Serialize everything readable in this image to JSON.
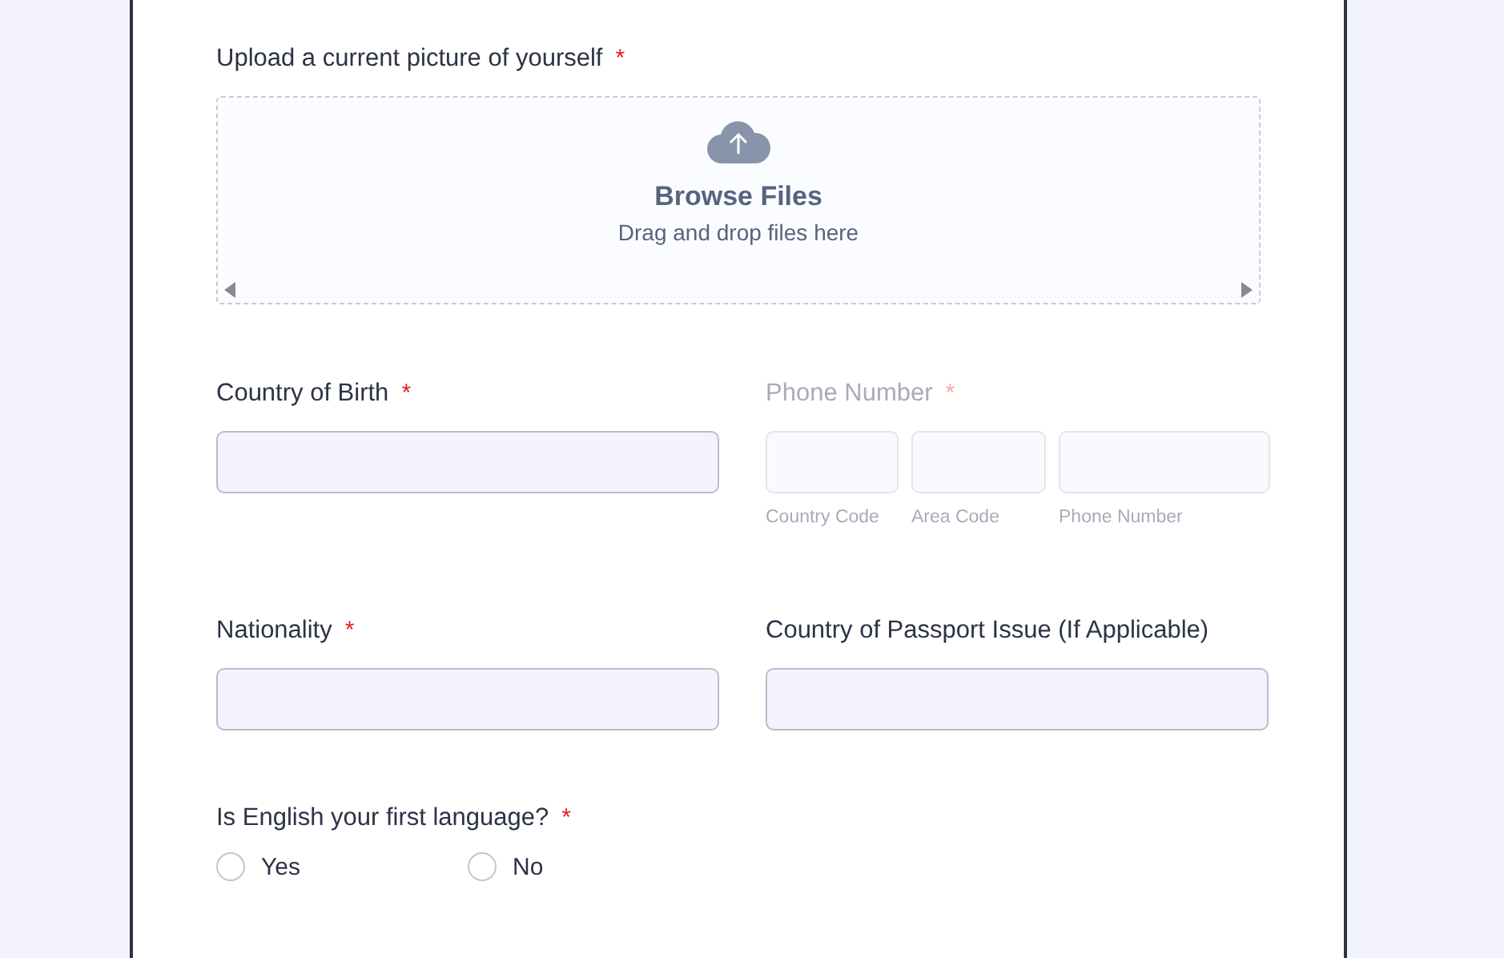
{
  "upload": {
    "label": "Upload a current picture of yourself",
    "required_mark": "*",
    "button": "Browse Files",
    "hint": "Drag and drop files here"
  },
  "rows": [
    {
      "kind": "pair",
      "fields": [
        {
          "kind": "text",
          "label": "Country of Birth",
          "required_mark": "*",
          "disabled": false
        },
        {
          "kind": "phone",
          "label": "Phone Number",
          "required_mark": "*",
          "disabled": true,
          "parts": [
            {
              "sublabel": "Country Code"
            },
            {
              "sublabel": "Area Code"
            },
            {
              "sublabel": "Phone Number"
            }
          ]
        }
      ]
    },
    {
      "kind": "pair",
      "fields": [
        {
          "kind": "text",
          "label": "Nationality",
          "required_mark": "*",
          "disabled": false
        },
        {
          "kind": "text",
          "label": "Country of Passport Issue (If Applicable)",
          "disabled": false
        }
      ]
    }
  ],
  "question": {
    "label": "Is English your first language?",
    "required_mark": "*",
    "options": [
      {
        "label": "Yes",
        "selected": false
      },
      {
        "label": "No",
        "selected": false
      }
    ]
  }
}
